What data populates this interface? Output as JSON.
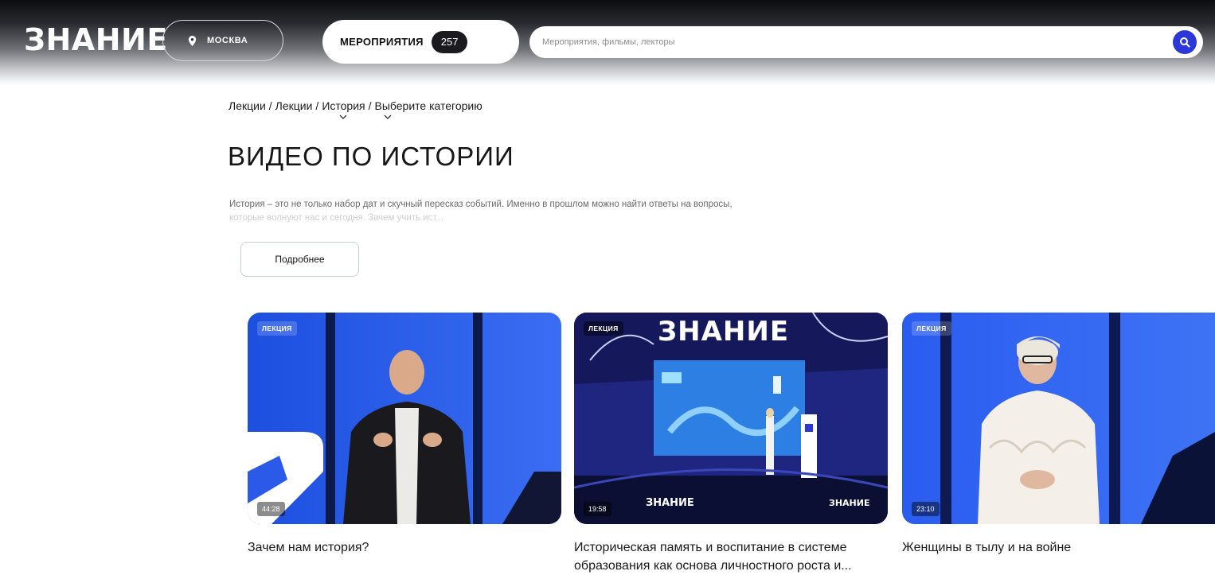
{
  "header": {
    "logo": "ЗНАНИЕ",
    "city": "МОСКВА",
    "events_label": "МЕРОПРИЯТИЯ",
    "events_count": "257",
    "search_placeholder": "Мероприятия, фильмы, лекторы",
    "icons": [
      "location-pin-icon",
      "search-icon"
    ],
    "accent": "#2c37d8"
  },
  "breadcrumb": {
    "items": [
      "Лекции",
      "Лекции",
      "История",
      "Выберите категорию"
    ],
    "separator": "/"
  },
  "page": {
    "title": "ВИДЕО ПО ИСТОРИИ",
    "description": "История – это не только набор дат и скучный пересказ событий. Именно в прошлом можно найти ответы на вопросы,",
    "description_fade": "которые волнуют нас и сегодня. Зачем учить ист...",
    "more_button": "Подробнее"
  },
  "cards": [
    {
      "badge": "ЛЕКЦИЯ",
      "duration": "44:28",
      "title": "Зачем нам история?"
    },
    {
      "badge": "ЛЕКЦИЯ",
      "duration": "19:58",
      "title": "Историческая память и воспитание в системе образования как основа личностного роста и...",
      "thumb_text": "ЗНАНИЕ"
    },
    {
      "badge": "ЛЕКЦИЯ",
      "duration": "23:10",
      "title": "Женщины в тылу и на войне"
    }
  ]
}
